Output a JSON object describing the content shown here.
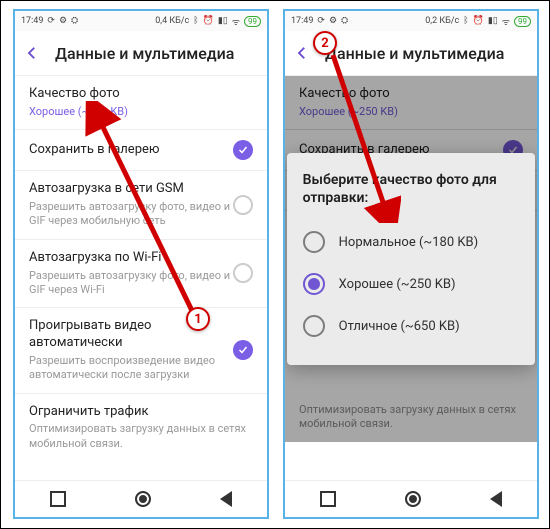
{
  "statusbar": {
    "time": "17:49",
    "net_left": "0,4 КБ/с",
    "net_right": "0,2 КБ/с",
    "battery": "99"
  },
  "header": {
    "title": "Данные и мультимедиа"
  },
  "rows": {
    "quality": {
      "title": "Качество фото",
      "sub": "Хорошее (~250 KB)"
    },
    "gallery": {
      "title": "Сохранить в галерею"
    },
    "gsm": {
      "title": "Автозагрузка в сети GSM",
      "sub": "Разрешить автозагрузку фото, видео и GIF через мобильную сеть"
    },
    "wifi": {
      "title": "Автозагрузка по Wi-Fi",
      "sub": "Разрешить автозагрузку фото, видео и GIF через Wi-Fi"
    },
    "autoplay": {
      "title": "Проигрывать видео автоматически",
      "sub": "Разрешить воспроизведение видео автоматически после загрузки"
    },
    "traffic": {
      "title": "Ограничить трафик",
      "sub": "Оптимизировать загрузку данных в сетях мобильной связи."
    }
  },
  "dialog": {
    "title": "Выберите качество фото для отправки:",
    "options": [
      {
        "label": "Нормальное (~180 KB)",
        "selected": false
      },
      {
        "label": "Хорошее (~250 KB)",
        "selected": true
      },
      {
        "label": "Отличное (~650 KB)",
        "selected": false
      }
    ]
  },
  "annotations": {
    "badge1": "1",
    "badge2": "2"
  }
}
